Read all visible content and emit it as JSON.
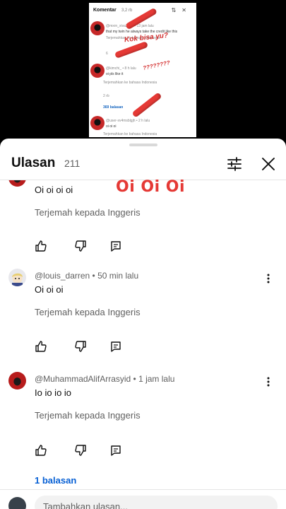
{
  "video": {
    "panel_title": "Komentar",
    "panel_count": "3,2 rb",
    "lines": [
      "@mxrn_xiva2019 • 13 jam lalu",
      "that my twin he always take the credit like this",
      "Terjemahkan ke bahasa Indonesia",
      "@kimchi_ • 8 h lalu",
      "oi pls like it",
      "Terjemahkan ke bahasa Indonesia",
      "369 balasan",
      "@user-xv4msblgjh • 2 h lalu",
      "oi oi oi",
      "Terjemahkan ke bahasa Indonesia"
    ],
    "like_counts": [
      "6",
      "2 rb"
    ],
    "stickers": [
      "Kok bisa yu?",
      "????????"
    ]
  },
  "sheet": {
    "title": "Ulasan",
    "count": "211",
    "filter_icon": "sliders-icon",
    "close_icon": "close-icon"
  },
  "overlay": {
    "text": "Oi Oi Oi"
  },
  "comments": [
    {
      "author_meta": "",
      "text": "Oi oi oi oi",
      "translate": "Terjemah kepada Inggeris",
      "avatar": "red-circle"
    },
    {
      "author_meta": "@louis_darren • 50 min lalu",
      "text": "Oi oi oi",
      "translate": "Terjemah kepada Inggeris",
      "avatar": "cartoon-face"
    },
    {
      "author_meta": "@MuhammadAlifArrasyid • 1 jam lalu",
      "text": "Io io io io",
      "translate": "Terjemah kepada Inggeris",
      "avatar": "red-circle",
      "replies": "1 balasan"
    }
  ],
  "reply_bar": {
    "placeholder": "Tambahkan ulasan..."
  },
  "colors": {
    "accent_link": "#065fd4",
    "overlay_red": "#e53935",
    "sheet_bg": "#ffffff"
  }
}
